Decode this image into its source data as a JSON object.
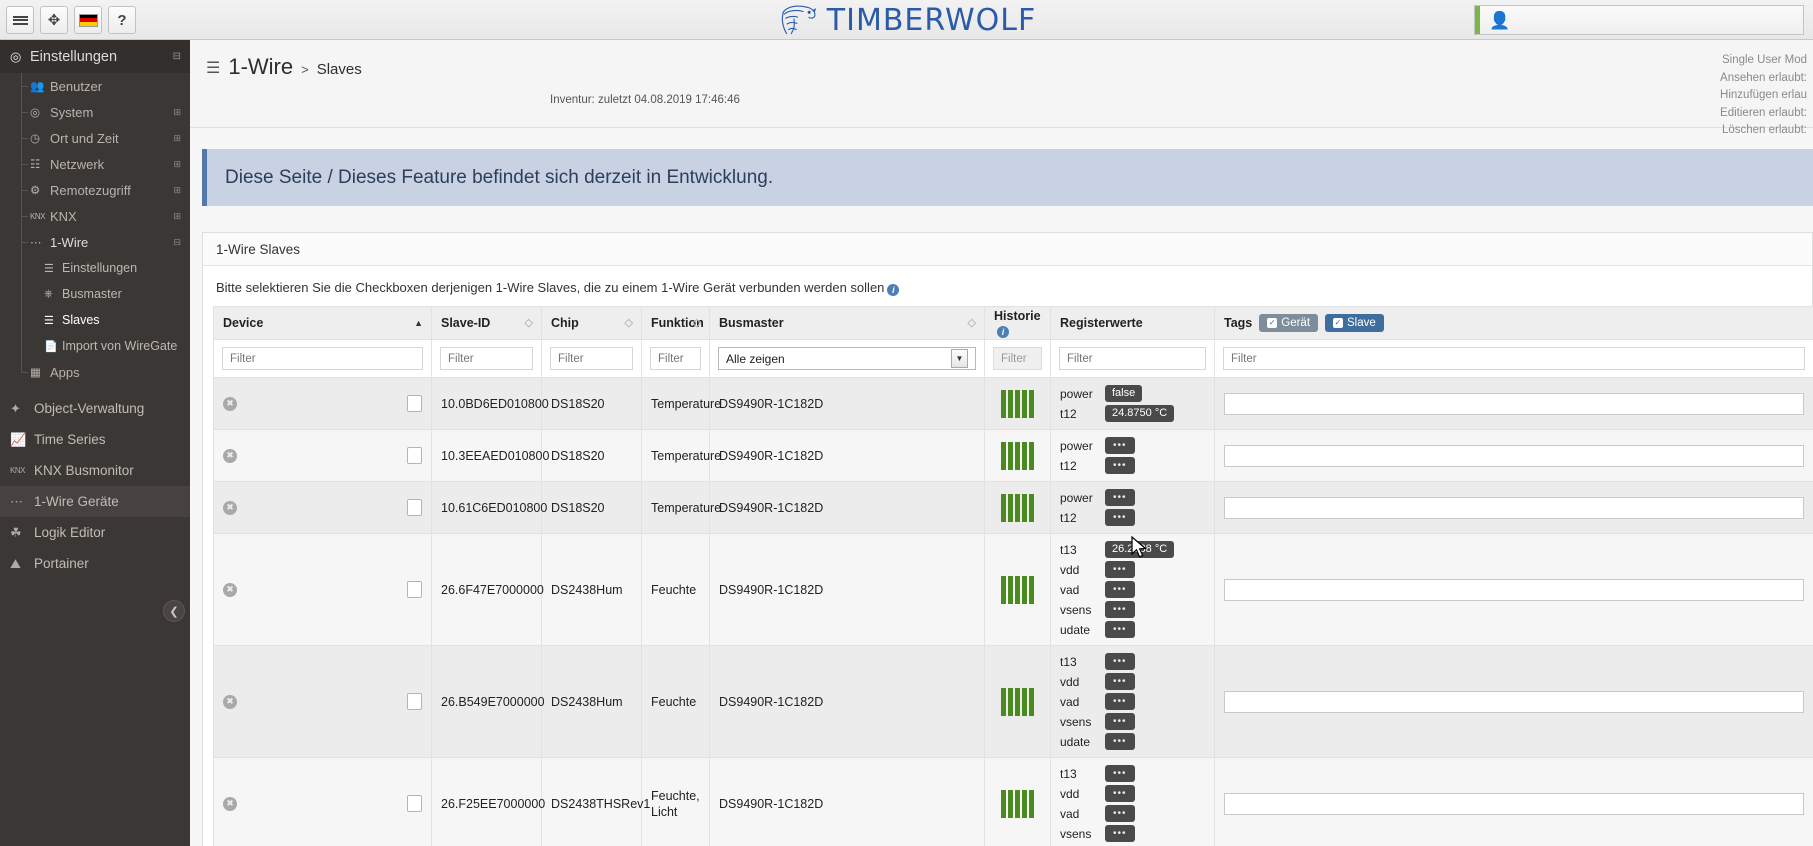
{
  "topbar": {
    "menu_icon": "hamburger-icon",
    "fullscreen_icon": "expand-arrows-icon",
    "flag_icon": "german-flag-icon",
    "help_label": "?",
    "logo_text": "TIMBERWOLF",
    "user_icon": "user-avatar-icon"
  },
  "sidebar": {
    "header": {
      "label": "Einstellungen",
      "icon": "dashboard-icon",
      "expander": "⊟"
    },
    "items": [
      {
        "label": "Benutzer",
        "icon": "users-icon",
        "expander": ""
      },
      {
        "label": "System",
        "icon": "dashboard-icon",
        "expander": "⊞"
      },
      {
        "label": "Ort und Zeit",
        "icon": "clock-icon",
        "expander": "⊞"
      },
      {
        "label": "Netzwerk",
        "icon": "network-icon",
        "expander": "⊞"
      },
      {
        "label": "Remotezugriff",
        "icon": "gears-icon",
        "expander": "⊞"
      },
      {
        "label": "KNX",
        "icon": "knx-icon",
        "expander": "⊞"
      },
      {
        "label": "1-Wire",
        "icon": "onewire-icon",
        "expander": "⊟"
      }
    ],
    "subitems": [
      {
        "label": "Einstellungen",
        "icon": "sliders-icon",
        "active": false
      },
      {
        "label": "Busmaster",
        "icon": "usb-icon",
        "active": false
      },
      {
        "label": "Slaves",
        "icon": "list-icon",
        "active": true
      },
      {
        "label": "Import von WireGate",
        "icon": "file-icon",
        "active": false
      }
    ],
    "apps": {
      "label": "Apps",
      "icon": "apps-grid-icon"
    },
    "main_items": [
      {
        "label": "Object-Verwaltung",
        "icon": "magic-wand-icon",
        "highlight": false
      },
      {
        "label": "Time Series",
        "icon": "chart-line-icon",
        "highlight": false
      },
      {
        "label": "KNX Busmonitor",
        "icon": "knx-icon",
        "highlight": false
      },
      {
        "label": "1-Wire Geräte",
        "icon": "onewire-icon",
        "highlight": true
      },
      {
        "label": "Logik Editor",
        "icon": "brain-icon",
        "highlight": false
      },
      {
        "label": "Portainer",
        "icon": "container-icon",
        "highlight": false
      }
    ],
    "collapse_icon": "chevron-left-circle-icon"
  },
  "page": {
    "breadcrumb_icon": "list-icon",
    "breadcrumb_main": "1-Wire",
    "breadcrumb_sep": ">",
    "breadcrumb_sub": "Slaves",
    "inventur": "Inventur: zuletzt 04.08.2019 17:46:46",
    "permissions": [
      "Single User Mod",
      "Ansehen erlaubt:",
      "Hinzufügen erlau",
      "Editieren erlaubt:",
      "Löschen erlaubt:"
    ],
    "notice": "Diese Seite / Dieses Feature befindet sich derzeit in Entwicklung.",
    "panel_title": "1-Wire Slaves",
    "hint": "Bitte selektieren Sie die Checkboxen derjenigen 1-Wire Slaves, die zu einem 1-Wire Gerät verbunden werden sollen"
  },
  "table": {
    "columns": [
      {
        "label": "Device",
        "sort": "asc"
      },
      {
        "label": "Slave-ID",
        "sort": "both"
      },
      {
        "label": "Chip",
        "sort": "both"
      },
      {
        "label": "Funktion",
        "sort": "both"
      },
      {
        "label": "Busmaster",
        "sort": "both"
      },
      {
        "label": "Historie",
        "sort": "none",
        "info": true
      },
      {
        "label": "Registerwerte",
        "sort": "none"
      },
      {
        "label": "Tags",
        "sort": "none"
      }
    ],
    "tag_chips": [
      {
        "label": "Gerät",
        "style": "gray",
        "checked": true
      },
      {
        "label": "Slave",
        "style": "blue",
        "checked": true
      }
    ],
    "filters": {
      "device": "Filter",
      "slave_id": "Filter",
      "chip": "Filter",
      "funktion": "Filter",
      "busmaster": "Alle zeigen",
      "historie": "Filter",
      "registerwerte": "Filter",
      "tags": "Filter"
    },
    "rows": [
      {
        "delete_icon": "delete-circle-icon",
        "checked": false,
        "slave_id": "10.0BD6ED010800",
        "chip": "DS18S20",
        "funktion": "Temperature",
        "busmaster": "DS9490R-1C182D",
        "history_bars": 5,
        "registers": [
          {
            "name": "power",
            "value": "false",
            "collapsed": false
          },
          {
            "name": "t12",
            "value": "24.8750 °C",
            "collapsed": false
          }
        ],
        "tag_value": ""
      },
      {
        "delete_icon": "delete-circle-icon",
        "checked": false,
        "slave_id": "10.3EEAED010800",
        "chip": "DS18S20",
        "funktion": "Temperature",
        "busmaster": "DS9490R-1C182D",
        "history_bars": 5,
        "registers": [
          {
            "name": "power",
            "value": "•••",
            "collapsed": true
          },
          {
            "name": "t12",
            "value": "•••",
            "collapsed": true
          }
        ],
        "tag_value": ""
      },
      {
        "delete_icon": "delete-circle-icon",
        "checked": false,
        "slave_id": "10.61C6ED010800",
        "chip": "DS18S20",
        "funktion": "Temperature",
        "busmaster": "DS9490R-1C182D",
        "history_bars": 5,
        "registers": [
          {
            "name": "power",
            "value": "•••",
            "collapsed": true
          },
          {
            "name": "t12",
            "value": "•••",
            "collapsed": true
          }
        ],
        "tag_value": ""
      },
      {
        "delete_icon": "delete-circle-icon",
        "checked": false,
        "slave_id": "26.6F47E7000000",
        "chip": "DS2438Hum",
        "funktion": "Feuchte",
        "busmaster": "DS9490R-1C182D",
        "history_bars": 5,
        "registers": [
          {
            "name": "t13",
            "value": "26.2188 °C",
            "collapsed": false
          },
          {
            "name": "vdd",
            "value": "•••",
            "collapsed": true
          },
          {
            "name": "vad",
            "value": "•••",
            "collapsed": true
          },
          {
            "name": "vsens",
            "value": "•••",
            "collapsed": true
          },
          {
            "name": "udate",
            "value": "•••",
            "collapsed": true
          }
        ],
        "tag_value": ""
      },
      {
        "delete_icon": "delete-circle-icon",
        "checked": false,
        "slave_id": "26.B549E7000000",
        "chip": "DS2438Hum",
        "funktion": "Feuchte",
        "busmaster": "DS9490R-1C182D",
        "history_bars": 5,
        "registers": [
          {
            "name": "t13",
            "value": "•••",
            "collapsed": true
          },
          {
            "name": "vdd",
            "value": "•••",
            "collapsed": true
          },
          {
            "name": "vad",
            "value": "•••",
            "collapsed": true
          },
          {
            "name": "vsens",
            "value": "•••",
            "collapsed": true
          },
          {
            "name": "udate",
            "value": "•••",
            "collapsed": true
          }
        ],
        "tag_value": ""
      },
      {
        "delete_icon": "delete-circle-icon",
        "checked": false,
        "slave_id": "26.F25EE7000000",
        "chip": "DS2438THSRev1",
        "funktion": "Feuchte, Licht",
        "busmaster": "DS9490R-1C182D",
        "history_bars": 5,
        "registers": [
          {
            "name": "t13",
            "value": "•••",
            "collapsed": true
          },
          {
            "name": "vdd",
            "value": "•••",
            "collapsed": true
          },
          {
            "name": "vad",
            "value": "•••",
            "collapsed": true
          },
          {
            "name": "vsens",
            "value": "•••",
            "collapsed": true
          }
        ],
        "tag_value": ""
      }
    ]
  },
  "colors": {
    "accent_blue": "#2b5ba8",
    "history_green": "#4a8a1e",
    "notice_bg": "#c8d2e2",
    "sidebar_bg": "#3b3734",
    "tag_gray": "#7d8d9c",
    "tag_blue": "#3f6e9e"
  }
}
